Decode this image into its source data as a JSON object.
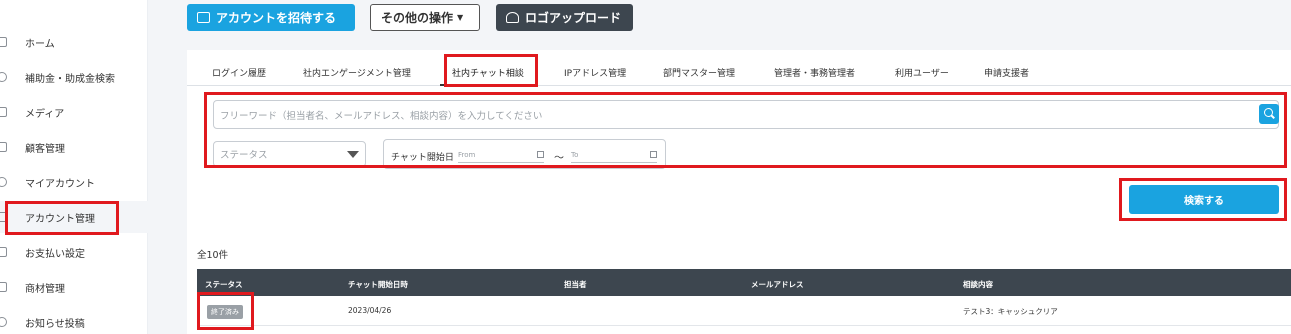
{
  "sidebar": {
    "items": [
      {
        "label": "ホーム",
        "icon": "home-icon"
      },
      {
        "label": "補助金・助成金検索",
        "icon": "search-icon"
      },
      {
        "label": "メディア",
        "icon": "media-icon"
      },
      {
        "label": "顧客管理",
        "icon": "customer-icon"
      },
      {
        "label": "マイアカウント",
        "icon": "user-icon"
      },
      {
        "label": "アカウント管理",
        "icon": "account-icon"
      },
      {
        "label": "お支払い設定",
        "icon": "card-icon"
      },
      {
        "label": "商材管理",
        "icon": "product-icon"
      },
      {
        "label": "お知らせ投稿",
        "icon": "info-icon"
      }
    ]
  },
  "toolbar": {
    "invite_label": "アカウントを招待する",
    "other_label": "その他の操作",
    "logo_label": "ロゴアップロード"
  },
  "tabs": [
    {
      "label": "ログイン履歴"
    },
    {
      "label": "社内エンゲージメント管理"
    },
    {
      "label": "社内チャット相談"
    },
    {
      "label": "IPアドレス管理"
    },
    {
      "label": "部門マスター管理"
    },
    {
      "label": "管理者・事務管理者"
    },
    {
      "label": "利用ユーザー"
    },
    {
      "label": "申請支援者"
    }
  ],
  "filters": {
    "search_placeholder": "フリーワード（担当者名、メールアドレス、相談内容）を入力してください",
    "status_placeholder": "ステータス",
    "date_label": "チャット開始日",
    "date_from_placeholder": "From",
    "date_to_placeholder": "To",
    "tilde": "～",
    "submit_label": "検索する"
  },
  "results": {
    "count_label": "全10件"
  },
  "table": {
    "headers": [
      "ステータス",
      "チャット開始日時",
      "担当者",
      "メールアドレス",
      "相談内容"
    ],
    "rows": [
      {
        "status": "終了済み",
        "date": "2023/04/26",
        "assignee": "",
        "email": "",
        "content": "テスト3：キャッシュクリア"
      }
    ]
  },
  "colors": {
    "accent": "#1aa3e0",
    "dark": "#3d464f",
    "highlight": "#e0191e"
  }
}
